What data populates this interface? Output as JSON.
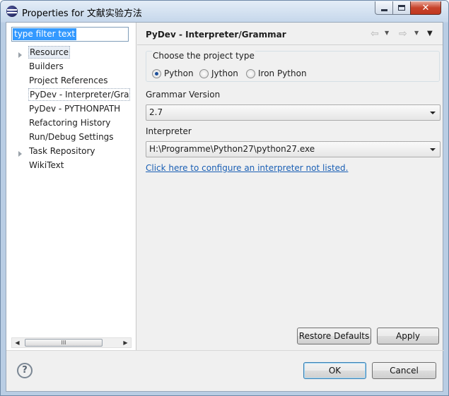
{
  "window": {
    "title": "Properties for 文献实验方法",
    "close_glyph": "✕"
  },
  "filter": {
    "value": "type filter text"
  },
  "tree": {
    "items": [
      {
        "label": "Resource",
        "expandable": true,
        "selected": true
      },
      {
        "label": "Builders"
      },
      {
        "label": "Project References"
      },
      {
        "label": "PyDev - Interpreter/Grammar",
        "focused": true
      },
      {
        "label": "PyDev - PYTHONPATH"
      },
      {
        "label": "Refactoring History"
      },
      {
        "label": "Run/Debug Settings"
      },
      {
        "label": "Task Repository",
        "expandable": true
      },
      {
        "label": "WikiText"
      }
    ],
    "scrollbar_grip": "III",
    "scroll_left": "◀",
    "scroll_right": "▶"
  },
  "page": {
    "title": "PyDev - Interpreter/Grammar",
    "nav_back_glyph": "⇦",
    "nav_forward_glyph": "⇨",
    "dropdown_glyph": "▼",
    "view_menu_glyph": "▼"
  },
  "project_type": {
    "legend": "Choose the project type",
    "options": [
      {
        "label": "Python",
        "checked": true
      },
      {
        "label": "Jython",
        "checked": false
      },
      {
        "label": "Iron Python",
        "checked": false
      }
    ]
  },
  "grammar": {
    "label": "Grammar Version",
    "value": "2.7"
  },
  "interpreter": {
    "label": "Interpreter",
    "value": "H:\\Programme\\Python27\\python27.exe",
    "configure_link": "Click here to configure an interpreter not listed."
  },
  "buttons": {
    "restore_defaults": "Restore Defaults",
    "apply": "Apply",
    "ok": "OK",
    "cancel": "Cancel",
    "help": "?"
  }
}
